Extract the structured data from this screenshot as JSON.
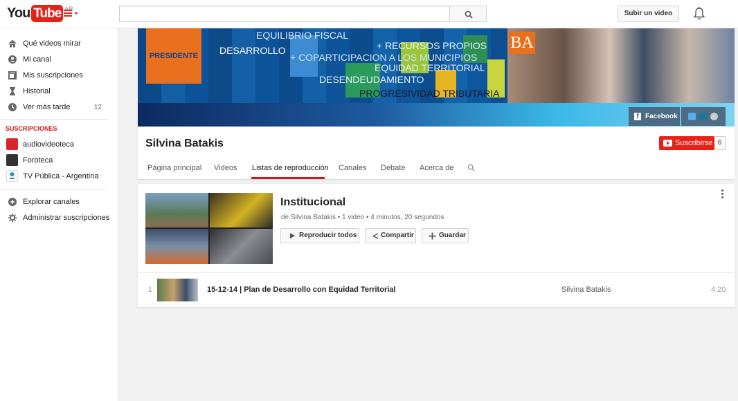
{
  "masthead": {
    "logo_you": "You",
    "logo_tube": "Tube",
    "logo_country": "AR",
    "search_placeholder": "",
    "upload_label": "Subir un video"
  },
  "sidebar": {
    "nav": [
      {
        "label": "Qué videos mirar",
        "icon": "home-icon"
      },
      {
        "label": "Mi canal",
        "icon": "user-icon"
      },
      {
        "label": "Mis suscripciones",
        "icon": "subscriptions-icon"
      },
      {
        "label": "Historial",
        "icon": "hourglass-icon"
      },
      {
        "label": "Ver más tarde",
        "icon": "clock-icon",
        "count": "12"
      }
    ],
    "subs_title": "SUSCRIPCIONES",
    "subscriptions": [
      {
        "label": "audiovideoteca",
        "color": "#d8242a"
      },
      {
        "label": "Foroteca",
        "color": "#333333"
      },
      {
        "label": "TV Pública - Argentina",
        "color": "#2a8fbd"
      }
    ],
    "footer": [
      {
        "label": "Explorar canales",
        "icon": "plus-circle-icon"
      },
      {
        "label": "Administrar suscripciones",
        "icon": "gear-icon"
      }
    ]
  },
  "banner": {
    "lines": [
      "EQUILIBRIO FISCAL",
      "DESARROLLO",
      "+ RECURSOS PROPIOS",
      "+ COPARTICIPACION A LOS MUNICIPIOS",
      "EQUIDAD TERRITORIAL",
      "DESENDEUDAMIENTO",
      "PROGRESIVIDAD TRIBUTARIA"
    ],
    "badge": "PRESIDENTE",
    "ba": "BA",
    "facebook_label": "Facebook"
  },
  "channel": {
    "name": "Silvina Batakis",
    "subscribe_label": "Suscribirse",
    "subscriber_count": "6",
    "tabs": [
      "Página principal",
      "Videos",
      "Listas de reproducción",
      "Canales",
      "Debate",
      "Acerca de"
    ],
    "active_tab": "Listas de reproducción"
  },
  "playlist": {
    "title": "Institucional",
    "meta": "de Silvina Batakis • 1 video • 4 minutos, 20 segundos",
    "play_all": "Reproducir todos",
    "share": "Compartir",
    "save": "Guardar",
    "items": [
      {
        "index": "1",
        "title": "15-12-14 | Plan de Desarrollo con Equidad Territorial",
        "owner": "Silvina Batakis",
        "duration": "4:20"
      }
    ]
  },
  "colors": {
    "brand_red": "#e62117",
    "accent_orange": "#e8701f",
    "banner_blue": "#0c5fa0"
  }
}
